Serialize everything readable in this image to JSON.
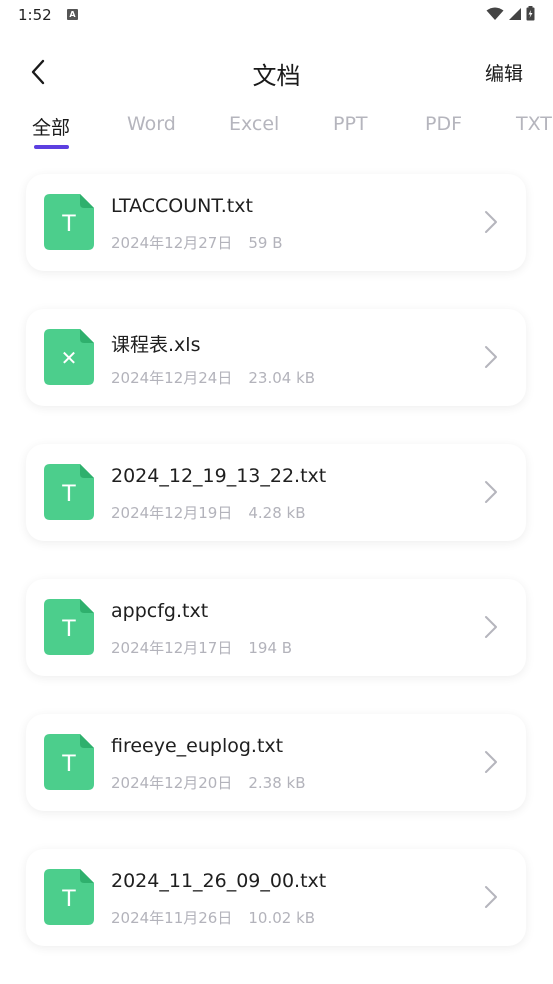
{
  "status": {
    "time": "1:52",
    "a_badge": "A"
  },
  "header": {
    "title": "文档",
    "edit_label": "编辑"
  },
  "tabs": [
    {
      "label": "全部",
      "active": true
    },
    {
      "label": "Word",
      "active": false
    },
    {
      "label": "Excel",
      "active": false
    },
    {
      "label": "PPT",
      "active": false
    },
    {
      "label": "PDF",
      "active": false
    },
    {
      "label": "TXT",
      "active": false
    }
  ],
  "colors": {
    "accent": "#5c3fe0",
    "file_icon_green": "#4cce8c",
    "file_icon_fold": "#2fb06d"
  },
  "files": [
    {
      "name": "LTACCOUNT.txt",
      "date": "2024年12月27日",
      "size": "59 B",
      "icon": "txt-file-icon",
      "glyph": "T"
    },
    {
      "name": "课程表.xls",
      "date": "2024年12月24日",
      "size": "23.04 kB",
      "icon": "xls-file-icon",
      "glyph": "✕"
    },
    {
      "name": "2024_12_19_13_22.txt",
      "date": "2024年12月19日",
      "size": "4.28 kB",
      "icon": "txt-file-icon",
      "glyph": "T"
    },
    {
      "name": "appcfg.txt",
      "date": "2024年12月17日",
      "size": "194 B",
      "icon": "txt-file-icon",
      "glyph": "T"
    },
    {
      "name": "fireeye_euplog.txt",
      "date": "2024年12月20日",
      "size": "2.38 kB",
      "icon": "txt-file-icon",
      "glyph": "T"
    },
    {
      "name": "2024_11_26_09_00.txt",
      "date": "2024年11月26日",
      "size": "10.02 kB",
      "icon": "txt-file-icon",
      "glyph": "T"
    }
  ]
}
